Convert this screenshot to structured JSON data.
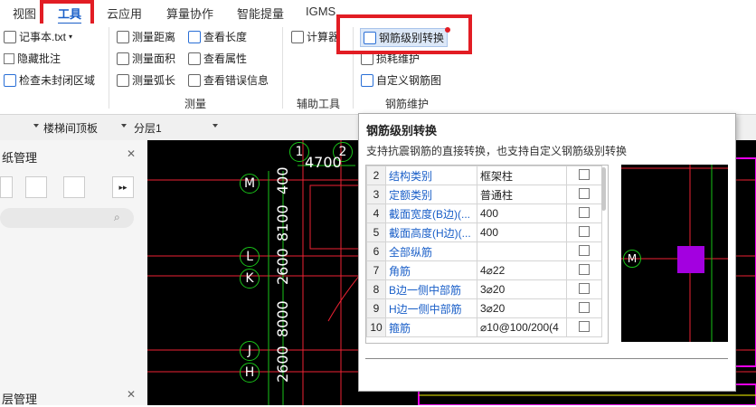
{
  "menu": {
    "tabs": [
      "视图",
      "工具",
      "云应用",
      "算量协作",
      "智能提量",
      "IGMS"
    ],
    "active_index": 1
  },
  "ribbon": {
    "notepad_label": "记事本.txt",
    "hide_annotation_label": "隐藏批注",
    "check_unclosed_label": "检查未封闭区域",
    "measure_distance": "测量距离",
    "measure_area": "测量面积",
    "measure_arc": "测量弧长",
    "view_length": "查看长度",
    "view_props": "查看属性",
    "view_errors": "查看错误信息",
    "calculator": "计算器",
    "rebar_grade_convert": "钢筋级别转换",
    "rebar_maintain": "损耗维护",
    "custom_rebar": "自定义钢筋图",
    "group_measure": "测量",
    "group_aux": "辅助工具",
    "group_rebar": "钢筋维护"
  },
  "toolbar2": {
    "dropdown1": "楼梯间顶板",
    "dropdown2": "分层1"
  },
  "leftpanel": {
    "title1": "纸管理",
    "title2": "层管理"
  },
  "canvas": {
    "top_axes": [
      "1",
      "2"
    ],
    "side_axes": [
      "M",
      "L",
      "K",
      "J",
      "H"
    ],
    "top_dim": "4700",
    "side_dims": [
      "400",
      "8100",
      "2600",
      "8000",
      "2600"
    ],
    "preview_axis": "M"
  },
  "dialog": {
    "title": "钢筋级别转换",
    "description": "支持抗震钢筋的直接转换，也支持自定义钢筋级别转换",
    "rows": [
      {
        "num": "2",
        "name": "结构类别",
        "value": "框架柱"
      },
      {
        "num": "3",
        "name": "定额类别",
        "value": "普通柱"
      },
      {
        "num": "4",
        "name": "截面宽度(B边)(...",
        "value": "400"
      },
      {
        "num": "5",
        "name": "截面高度(H边)(...",
        "value": "400"
      },
      {
        "num": "6",
        "name": "全部纵筋",
        "value": ""
      },
      {
        "num": "7",
        "name": "角筋",
        "value": "4⌀22"
      },
      {
        "num": "8",
        "name": "B边一侧中部筋",
        "value": "3⌀20"
      },
      {
        "num": "9",
        "name": "H边一侧中部筋",
        "value": "3⌀20"
      },
      {
        "num": "10",
        "name": "箍筋",
        "value": "⌀10@100/200(4"
      }
    ]
  },
  "colors": {
    "highlight_red": "#e21d24",
    "axis_green": "#19c419",
    "accent_blue": "#1a5fc8",
    "preview_purple": "#a300e0"
  }
}
